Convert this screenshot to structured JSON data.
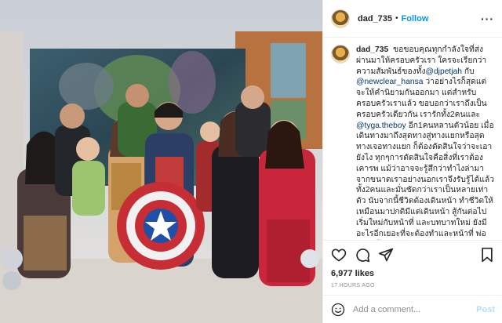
{
  "post": {
    "username": "dad_735",
    "follow_label": "Follow",
    "separator": "•",
    "more_label": "···"
  },
  "caption": {
    "username": "dad_735",
    "text_before": "ขอขอบคุณทุกกำลังใจที่ส่งผ่านมาให้ครอบครัวเรา ใครจะเรียกว่าความสัมพันธ์ของทั้ง",
    "mention1": "@djpetjah",
    "text_mid": " กับ ",
    "mention2": "@newclear_hansa",
    "text_after": " ว่าอย่างไรก็สุดแต่จะให้คำนิยามกันออกมา แต่สำหรับครอบครัวเราแล้ว ขอบอกว่าเราถึงเป็นครอบครัวเดียวกัน เรารักทั้ง2คนและ",
    "mention3": "@tyga.theboy",
    "text_end": " อีก1คนหลานตัวน้อย เมื่อเดินทางมาถึงสุดทางสู่ทางแยกหรือสุดทางเจอทางแยก ก็ต้องตัดสินใจว่าจะเอายังไง ทุกๆการตัดสินใจคือสิ่งที่เราต้องเคารพ แม้ว่าอาจจะรู้สึกว่าทำไงล่ามาจากขนาดเราอย่างนอกเราจึงรับรู้ได้แล้วทั้ง2คนและมั่นชัดกว่าเราเป็นหลายเท่าตัว นับจากนี้ชีวิตต้องเดินหน้า ทำชีวิตให้เหมือนมาปกติมีแต่เดินหน้า สู้กันต่อไป เริ่มใหม่กับหน้าที่ และบทบาทใหม่ ยังมีอะไรอีกเยอะที่จะต้องทำและหน้าที่ พ่อแม่จะต้องรับผิดชอบ ส่วนครอบครัวเราในฐานะพ่อคนหนึ่ง ขอยืนยันคำเดิม พ่อจะเป็นกำแพงให้ลูก ยามลูกอยากพิงเมื่อลูกเหนื่อย กำแพงให้ลูกเกาะยามลูกกำลังจะล้มลง กำแพงที่จะปกป้องไม่ให้ลูก"
  },
  "engagement": {
    "likes": "6,977 likes",
    "time": "17 HOURS AGO"
  },
  "comment_box": {
    "placeholder": "Add a comment...",
    "post_label": "Post"
  },
  "colors": {
    "accent": "#0095f6",
    "post_disabled": "#b2dffc",
    "mention": "#00376b"
  },
  "icons": [
    "avatar",
    "more-icon",
    "heart-icon",
    "comment-icon",
    "share-icon",
    "bookmark-icon",
    "emoji-icon"
  ]
}
